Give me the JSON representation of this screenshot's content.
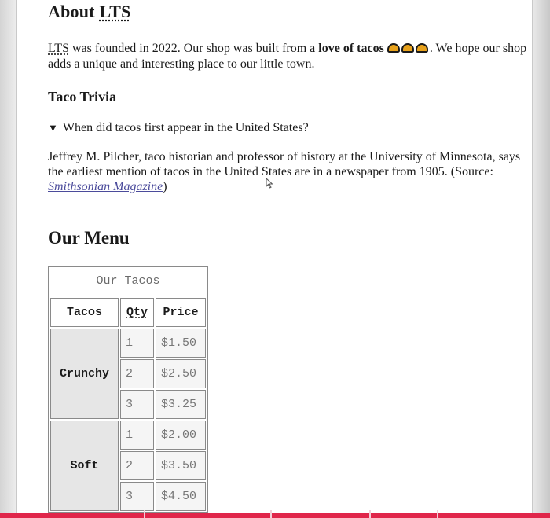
{
  "about": {
    "heading_prefix": "About ",
    "heading_abbr": "LTS"
  },
  "intro": {
    "abbr": "LTS",
    "text_before_bold": " was founded in 2022. Our shop was built from a ",
    "bold": "love of tacos",
    "emojis": [
      "taco-emoji",
      "taco-emoji",
      "taco-emoji"
    ],
    "text_after": ". We hope our shop adds a unique and interesting place to our little town."
  },
  "trivia": {
    "heading": "Taco Trivia",
    "question": "When did tacos first appear in the United States?",
    "answer_text": "Jeffrey M. Pilcher, taco historian and professor of history at the University of Minnesota, says the earliest mention of tacos in the United States are in a newspaper from 1905. (Source: ",
    "source_link": "Smithsonian Magazine",
    "answer_close": ")"
  },
  "menu": {
    "heading": "Our Menu",
    "table": {
      "caption": "Our Tacos",
      "headers": [
        "Tacos",
        "Qty",
        "Price"
      ],
      "groups": [
        {
          "name": "Crunchy",
          "rows": [
            {
              "qty": "1",
              "price": "$1.50"
            },
            {
              "qty": "2",
              "price": "$2.50"
            },
            {
              "qty": "3",
              "price": "$3.25"
            }
          ]
        },
        {
          "name": "Soft",
          "rows": [
            {
              "qty": "1",
              "price": "$2.00"
            },
            {
              "qty": "2",
              "price": "$3.50"
            },
            {
              "qty": "3",
              "price": "$4.50"
            }
          ]
        }
      ]
    }
  },
  "colors": {
    "link": "#4b4b9b",
    "taco_fill": "#e8a21c",
    "progress_red": "#e0264a",
    "row_header_bg": "#e6e6e6"
  }
}
